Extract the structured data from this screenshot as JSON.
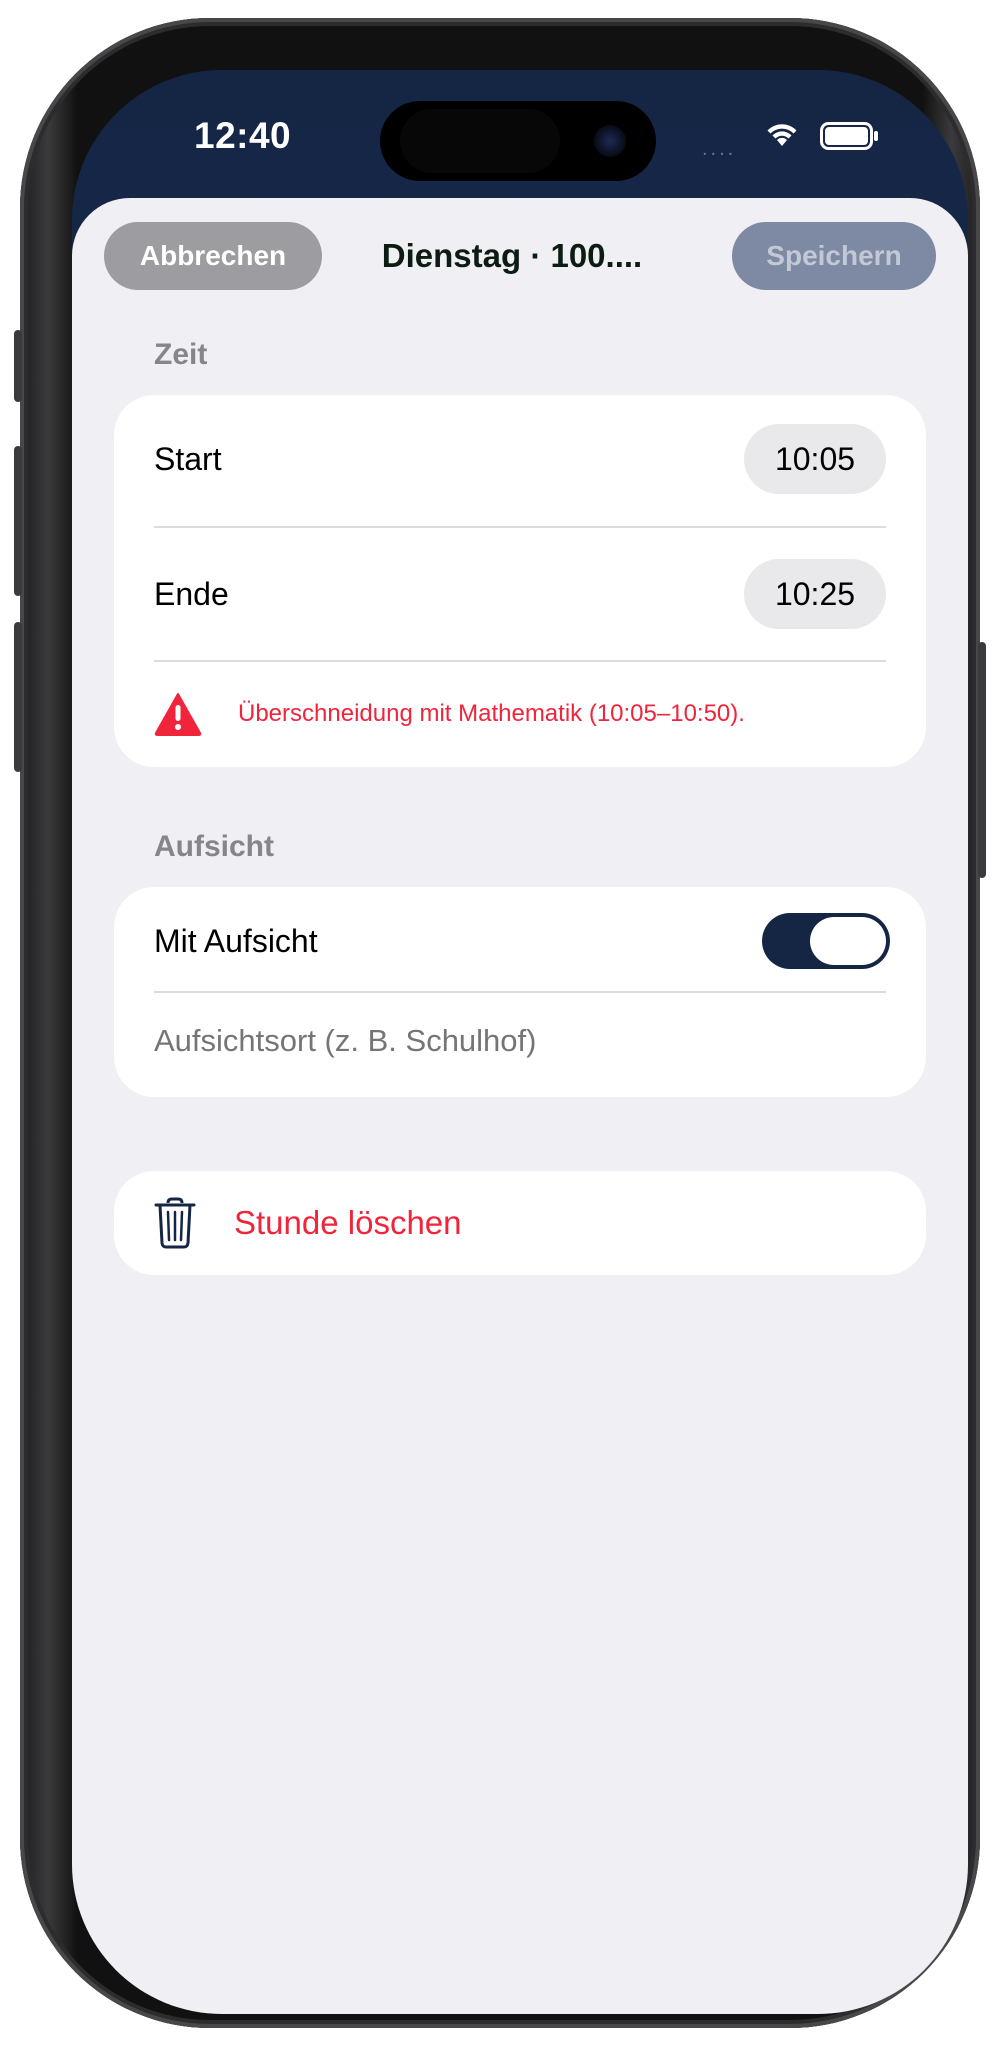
{
  "status_bar": {
    "time": "12:40",
    "signal": "....",
    "wifi_icon": "wifi-icon",
    "battery_icon": "battery-icon"
  },
  "header": {
    "cancel_label": "Abbrechen",
    "title": "Dienstag · 100....",
    "save_label": "Speichern"
  },
  "zeit": {
    "section_title": "Zeit",
    "start_label": "Start",
    "start_value": "10:05",
    "end_label": "Ende",
    "end_value": "10:25",
    "warning_icon": "warning-triangle-icon",
    "warning_text": "Überschneidung mit Mathematik (10:05–10:50)."
  },
  "aufsicht": {
    "section_title": "Aufsicht",
    "toggle_label": "Mit Aufsicht",
    "toggle_on": true,
    "location_value": "",
    "location_placeholder": "Aufsichtsort (z. B. Schulhof)"
  },
  "delete": {
    "icon": "trash-icon",
    "label": "Stunde löschen"
  },
  "colors": {
    "accent_navy": "#152645",
    "destructive_red": "#f0243a",
    "sheet_background": "#efeff4"
  }
}
